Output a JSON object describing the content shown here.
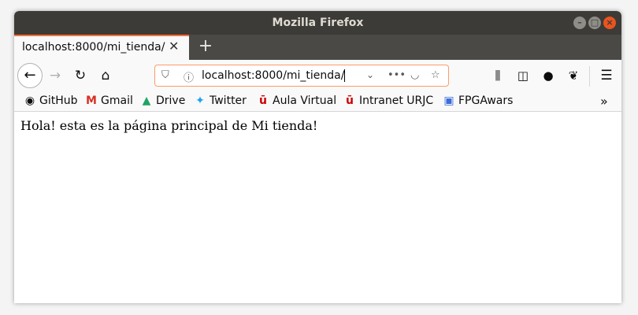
{
  "window": {
    "title": "Mozilla Firefox"
  },
  "tab": {
    "title": "localhost:8000/mi_tienda/",
    "close_glyph": "✕",
    "new_tab_glyph": "+"
  },
  "navbar": {
    "url": "localhost:8000/mi_tienda/"
  },
  "bookmarks": [
    {
      "label": "GitHub",
      "icon": "github-icon",
      "glyph": "◉"
    },
    {
      "label": "Gmail",
      "icon": "gmail-icon",
      "glyph": "M"
    },
    {
      "label": "Drive",
      "icon": "drive-icon",
      "glyph": "▲"
    },
    {
      "label": "Twitter",
      "icon": "twitter-icon",
      "glyph": "✦"
    },
    {
      "label": "Aula Virtual",
      "icon": "urjc-icon",
      "glyph": "ū"
    },
    {
      "label": "Intranet URJC",
      "icon": "urjc-icon",
      "glyph": "ū"
    },
    {
      "label": "FPGAwars",
      "icon": "fpgawars-icon",
      "glyph": "▣"
    }
  ],
  "page": {
    "text": "Hola! esta es la página principal de Mi tienda!"
  },
  "colors": {
    "accent": "#ff7139",
    "titlebar": "#3c3b37",
    "tabstrip": "#4a4945",
    "close": "#e9541f"
  }
}
